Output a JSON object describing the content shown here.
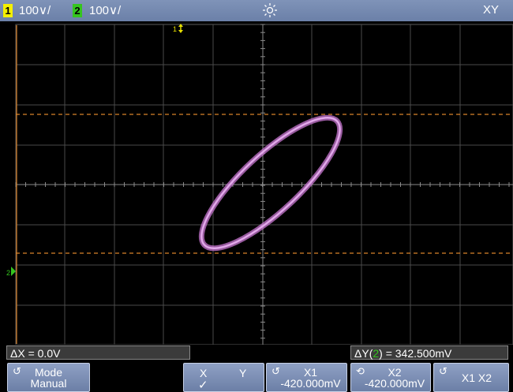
{
  "topbar": {
    "ch1_badge": "1",
    "ch1_scale": "100∨/",
    "ch2_badge": "2",
    "ch2_scale": "100∨/",
    "mode": "XY",
    "icons": {
      "ch1": "channel-1-badge",
      "ch2": "channel-2-badge",
      "brightness": "sun-icon"
    }
  },
  "screen": {
    "ch1_marker": "1",
    "ch2_marker": "2",
    "cursor_color": "#d9832a",
    "trace_color": "#d486df",
    "grid_color": "#4a4a4a"
  },
  "measurements": {
    "dx_label": "ΔX = 0.0V",
    "dy_prefix": "ΔY(",
    "dy_channel": "2",
    "dy_suffix": ") = 342.500mV"
  },
  "softkeys": {
    "mode_title": "Mode",
    "mode_value": "Manual",
    "x_label": "X",
    "y_label": "Y",
    "check": "✓",
    "x1_title": "X1",
    "x1_value": "-420.000mV",
    "x2_title": "X2",
    "x2_value": "-420.000mV",
    "x1x2_label": "X1 X2"
  }
}
